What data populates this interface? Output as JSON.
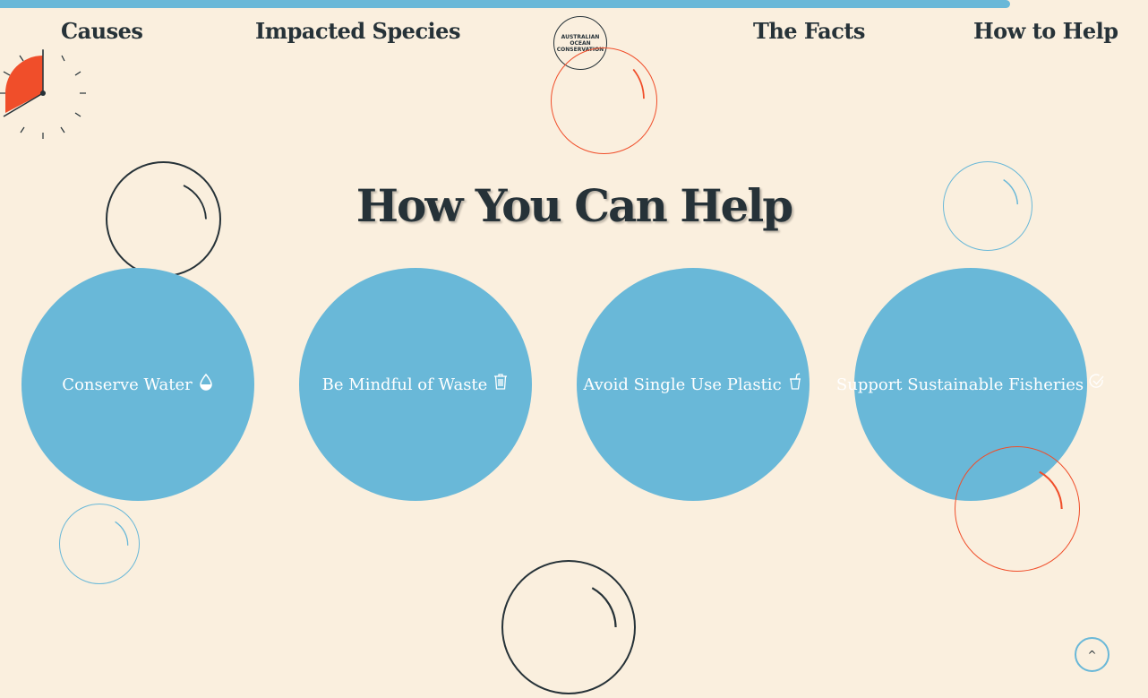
{
  "nav": {
    "causes": "Causes",
    "species": "Impacted Species",
    "facts": "The Facts",
    "help": "How to Help"
  },
  "logo": {
    "line1": "AUSTRALIAN",
    "line2": "OCEAN",
    "line3": "CONSERVATION"
  },
  "scroll_progress": 0.88,
  "heading": "How You Can Help",
  "cards": [
    {
      "label": "Conserve Water",
      "icon": "water-drop-icon"
    },
    {
      "label": "Be Mindful of Waste",
      "icon": "trash-icon"
    },
    {
      "label": "Avoid Single Use Plastic",
      "icon": "cup-icon"
    },
    {
      "label": "Support Sustainable Fisheries",
      "icon": "check-circle-icon"
    }
  ],
  "scroll_top_label": "^",
  "colors": {
    "background": "#faefde",
    "accent_blue": "#69b8d8",
    "accent_orange": "#f04e2a",
    "dark": "#263238"
  }
}
